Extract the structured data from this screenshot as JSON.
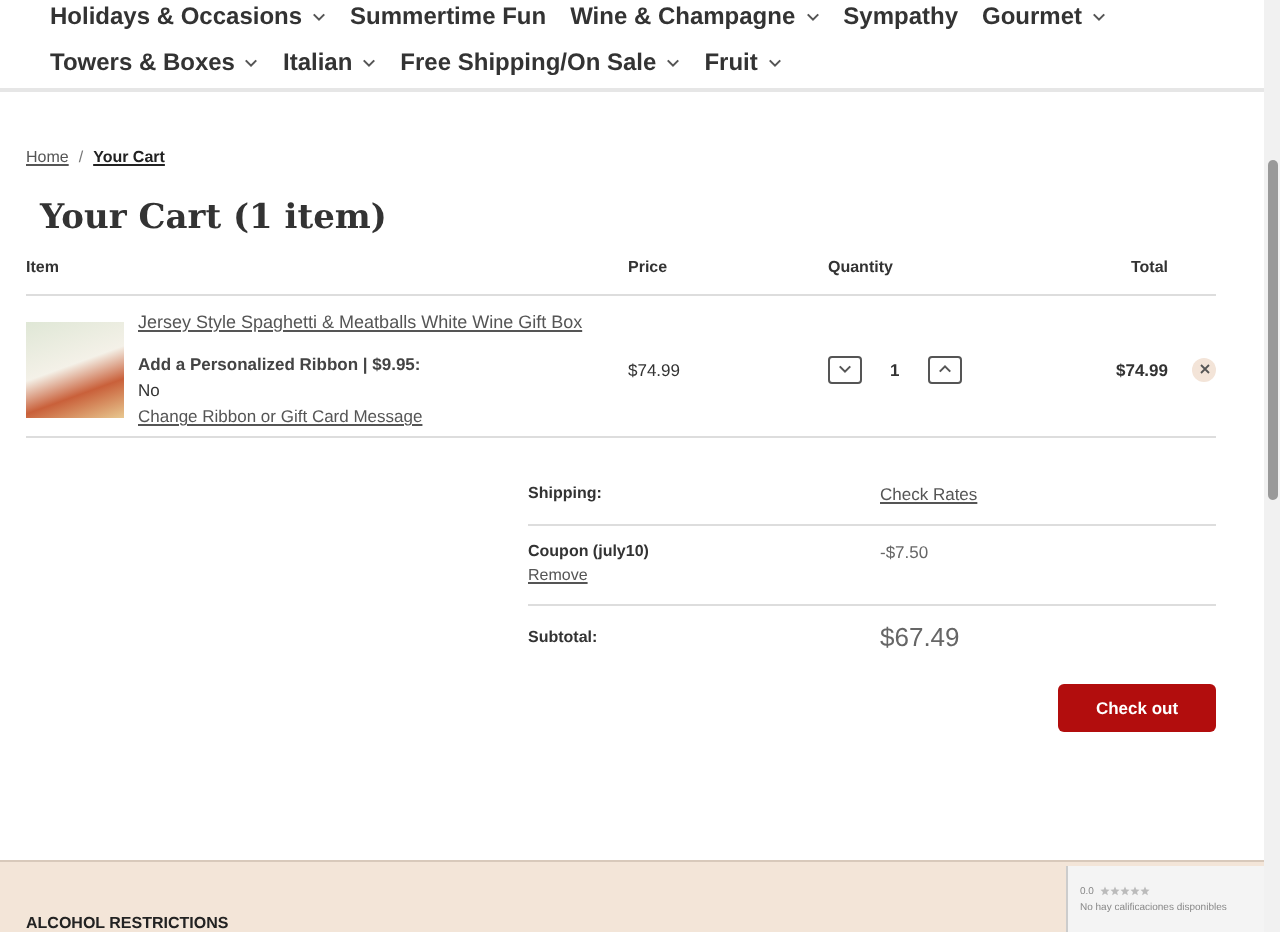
{
  "nav": [
    [
      {
        "label": "Holidays & Occasions",
        "dropdown": true
      },
      {
        "label": "Summertime Fun",
        "dropdown": false
      },
      {
        "label": "Wine & Champagne",
        "dropdown": true
      },
      {
        "label": "Sympathy",
        "dropdown": false
      },
      {
        "label": "Gourmet",
        "dropdown": true
      }
    ],
    [
      {
        "label": "Towers & Boxes",
        "dropdown": true
      },
      {
        "label": "Italian",
        "dropdown": true
      },
      {
        "label": "Free Shipping/On Sale",
        "dropdown": true
      },
      {
        "label": "Fruit",
        "dropdown": true
      }
    ]
  ],
  "breadcrumb": [
    {
      "label": "Home",
      "current": false
    },
    {
      "label": "Your Cart",
      "current": true
    }
  ],
  "breadcrumb_separator": "/",
  "title": "Your Cart (1 item)",
  "columns": [
    "Item",
    "Price",
    "Quantity",
    "Total"
  ],
  "items": [
    {
      "name": "Jersey Style Spaghetti & Meatballs White Wine Gift Box",
      "option_label": "Add a Personalized Ribbon | $9.95:",
      "option_value": "No",
      "change_link": "Change Ribbon or Gift Card Message",
      "price": "$74.99",
      "quantity": "1",
      "total": "$74.99"
    }
  ],
  "summary": [
    {
      "kind": "link",
      "label": "Shipping:",
      "value": "Check Rates"
    },
    {
      "kind": "coupon",
      "label": "Coupon (july10)",
      "value": "-$7.50",
      "action": "Remove"
    },
    {
      "kind": "total",
      "label": "Subtotal:",
      "value": "$67.49"
    }
  ],
  "checkout_button": "Check out",
  "footer": {
    "heading": "ALCOHOL RESTRICTIONS"
  },
  "rating_widget": {
    "score": "0.0",
    "stars": 0,
    "message": "No hay calificaciones disponibles"
  }
}
